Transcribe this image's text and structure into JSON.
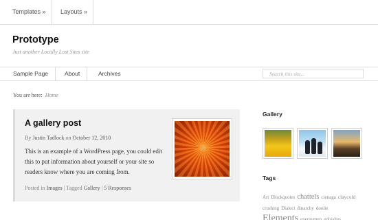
{
  "topbar": {
    "items": [
      {
        "label": "Templates »"
      },
      {
        "label": "Layouts »"
      }
    ]
  },
  "header": {
    "title": "Prototype",
    "tagline": "Just another Locally Lost Sites site"
  },
  "page_nav": {
    "items": [
      {
        "label": "Sample Page"
      },
      {
        "label": "About"
      },
      {
        "label": "Archives"
      }
    ],
    "search_placeholder": "Search this site..."
  },
  "breadcrumb": {
    "prefix": "You are here:",
    "current": "Home"
  },
  "post": {
    "title": "A gallery post",
    "by": "By",
    "author": "Justin Tadlock",
    "on": "on",
    "date": "October 12, 2010",
    "excerpt": "This is an example of a WordPress page, you could edit this to put information about yourself or your site so readers know where you are coming from.",
    "posted_in": "Posted in",
    "category": "Images",
    "sep1": "|",
    "tagged": "Tagged",
    "tag": "Gallery",
    "sep2": "|",
    "responses": "5 Responses"
  },
  "sidebar": {
    "gallery_title": "Gallery",
    "tags_title": "Tags",
    "tags": [
      {
        "label": "Art"
      },
      {
        "label": "Blockquotes"
      },
      {
        "label": "chattels"
      },
      {
        "label": "cienaga"
      },
      {
        "label": "claycold"
      },
      {
        "label": "crushing"
      },
      {
        "label": "Dialect"
      },
      {
        "label": "dinarchy"
      },
      {
        "label": "doolie"
      },
      {
        "label": "Elements"
      },
      {
        "label": "energumen"
      },
      {
        "label": "ephialtes"
      }
    ]
  }
}
